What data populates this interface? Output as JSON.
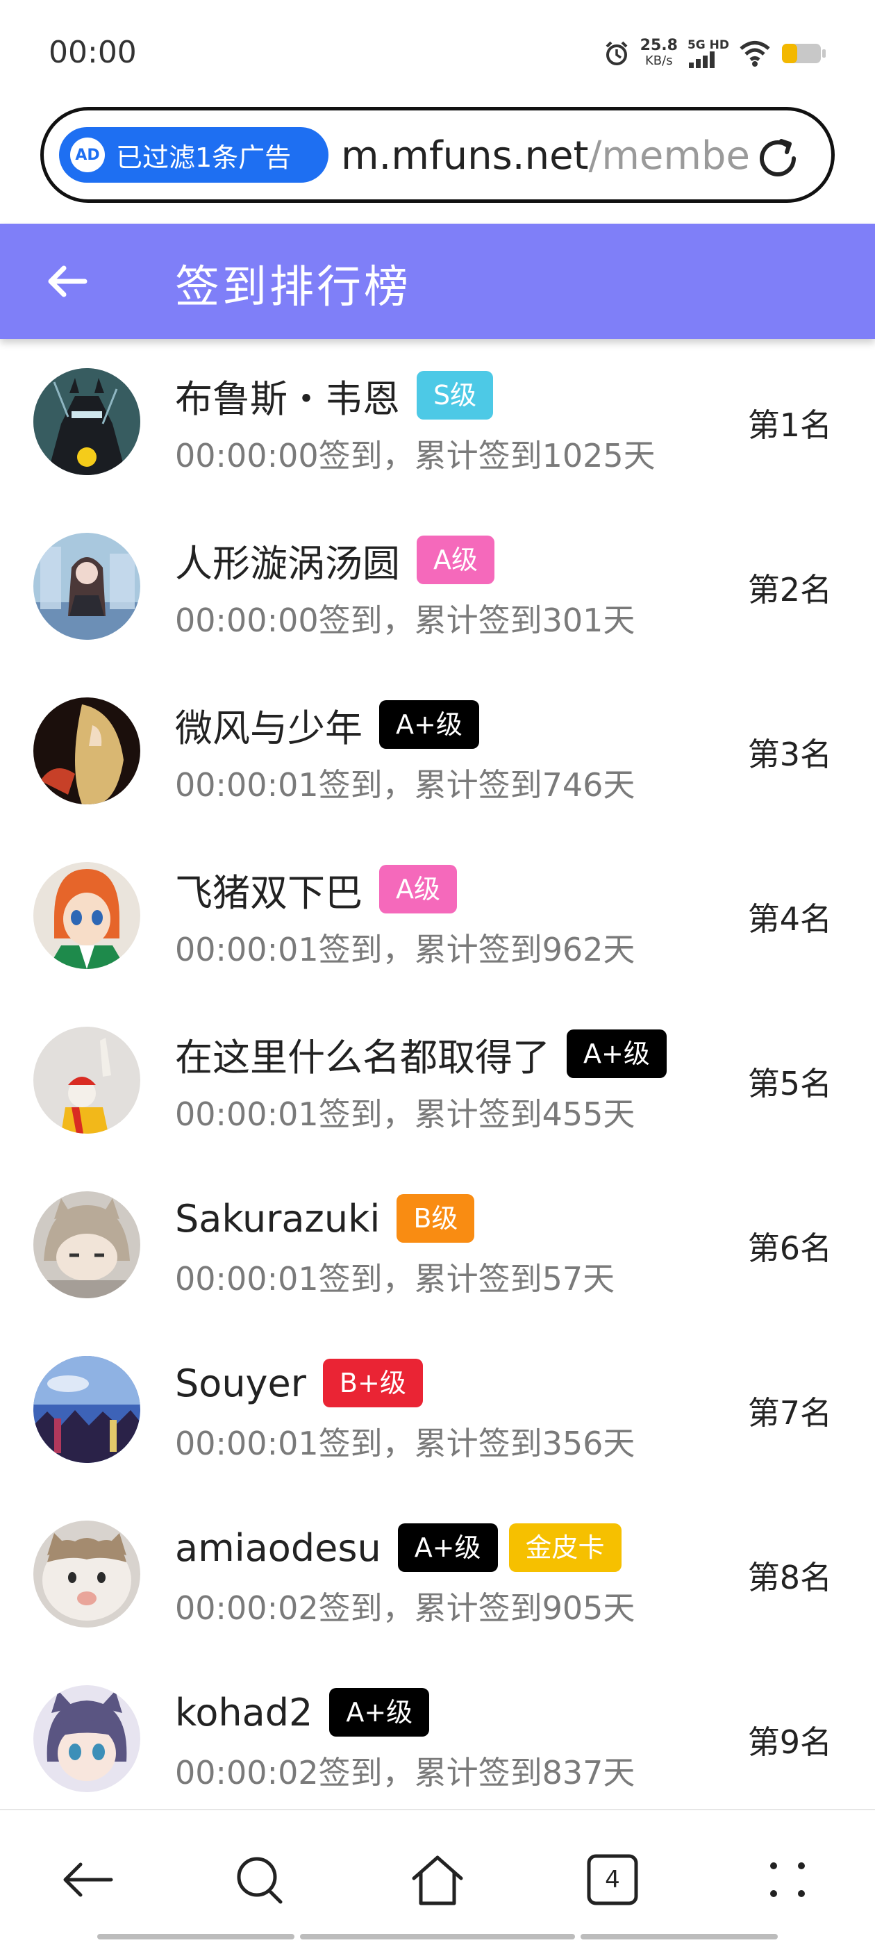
{
  "status_bar": {
    "time": "00:00",
    "speed_value": "25.8",
    "speed_unit": "KB/s",
    "network": "5G HD",
    "icons": [
      "alarm-icon",
      "signal-icon",
      "wifi-icon",
      "battery-icon"
    ]
  },
  "url_bar": {
    "ad_icon_text": "AD",
    "ad_filter_text": "已过滤1条广告",
    "domain": "m.mfuns.net",
    "path": "/membe"
  },
  "header": {
    "title": "签到排行榜",
    "color": "#7f7ff8"
  },
  "ranking": [
    {
      "name": "布鲁斯・韦恩",
      "badges": [
        {
          "text": "S级",
          "color": "cyan"
        }
      ],
      "subtitle": "00:00:00签到，累计签到1025天",
      "rank": "第1名"
    },
    {
      "name": "人形漩涡汤圆",
      "badges": [
        {
          "text": "A级",
          "color": "pink"
        }
      ],
      "subtitle": "00:00:00签到，累计签到301天",
      "rank": "第2名"
    },
    {
      "name": "微风与少年",
      "badges": [
        {
          "text": "A+级",
          "color": "black"
        }
      ],
      "subtitle": "00:00:01签到，累计签到746天",
      "rank": "第3名"
    },
    {
      "name": "飞猪双下巴",
      "badges": [
        {
          "text": "A级",
          "color": "pink"
        }
      ],
      "subtitle": "00:00:01签到，累计签到962天",
      "rank": "第4名"
    },
    {
      "name": "在这里什么名都取得了",
      "badges": [
        {
          "text": "A+级",
          "color": "black"
        }
      ],
      "subtitle": "00:00:01签到，累计签到455天",
      "rank": "第5名"
    },
    {
      "name": "Sakurazuki",
      "badges": [
        {
          "text": "B级",
          "color": "orange"
        }
      ],
      "subtitle": "00:00:01签到，累计签到57天",
      "rank": "第6名"
    },
    {
      "name": "Souyer",
      "badges": [
        {
          "text": "B+级",
          "color": "red"
        }
      ],
      "subtitle": "00:00:01签到，累计签到356天",
      "rank": "第7名"
    },
    {
      "name": "amiaodesu",
      "badges": [
        {
          "text": "A+级",
          "color": "black"
        },
        {
          "text": "金皮卡",
          "color": "gold"
        }
      ],
      "subtitle": "00:00:02签到，累计签到905天",
      "rank": "第8名"
    },
    {
      "name": "kohad2",
      "badges": [
        {
          "text": "A+级",
          "color": "black"
        }
      ],
      "subtitle": "00:00:02签到，累计签到837天",
      "rank": "第9名"
    }
  ],
  "bottom_nav": {
    "tab_count": "4",
    "icons": [
      "back-icon",
      "search-icon",
      "home-icon",
      "tabs-icon",
      "menu-icon"
    ]
  }
}
